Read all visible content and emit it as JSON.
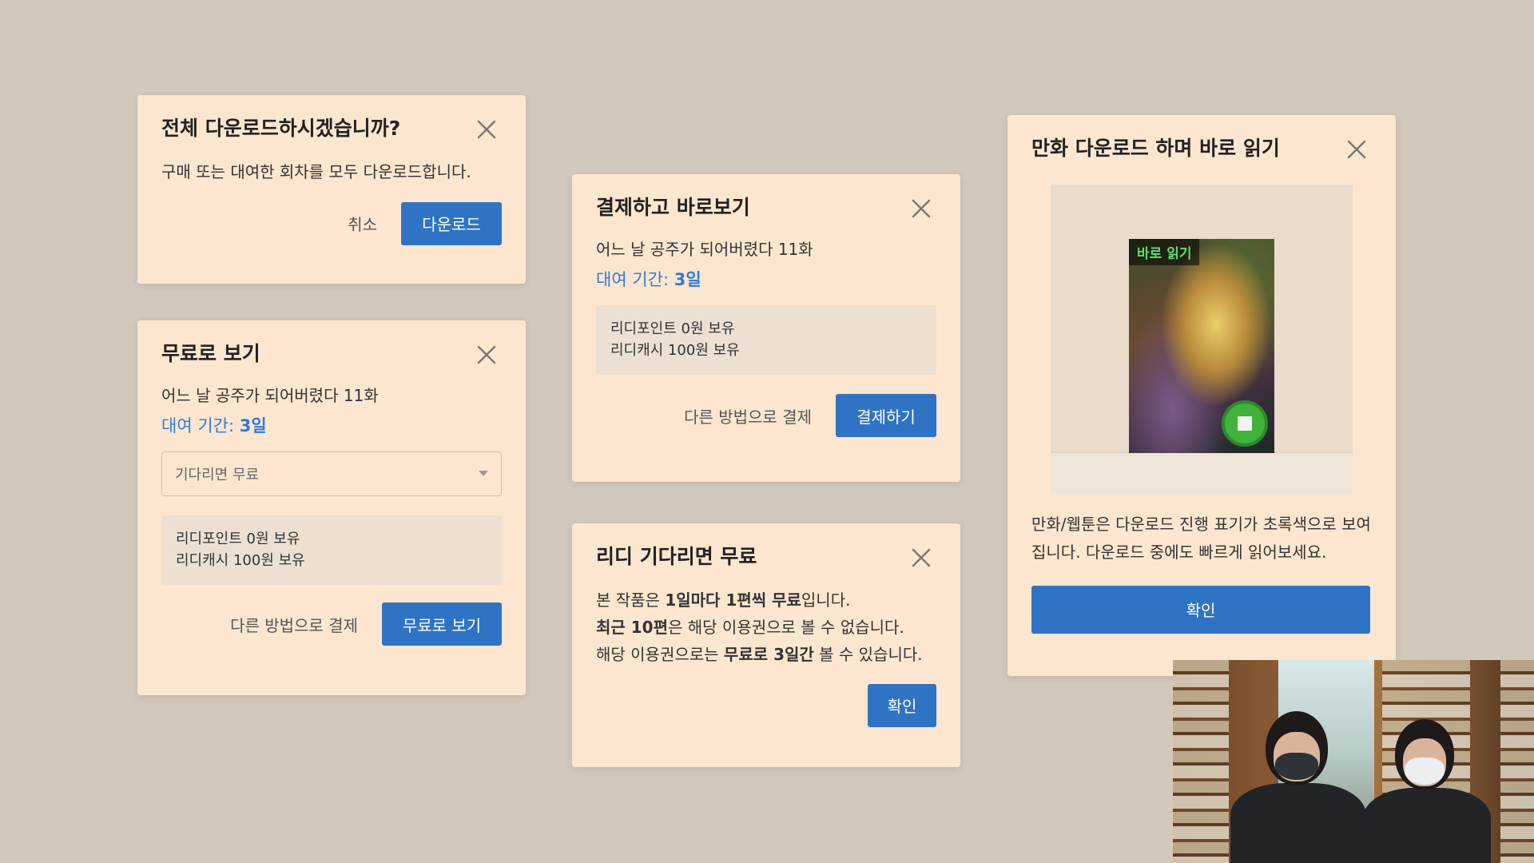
{
  "dialogs": {
    "download_all": {
      "title": "전체 다운로드하시겠습니까?",
      "description": "구매 또는 대여한 회차를 모두 다운로드합니다.",
      "cancel_label": "취소",
      "confirm_label": "다운로드"
    },
    "free_view": {
      "title": "무료로 보기",
      "episode": "어느 날 공주가 되어버렸다 11화",
      "rental_label": "대여 기간: ",
      "rental_value": "3일",
      "select_value": "기다리면 무료",
      "points_line": "리디포인트 0원 보유",
      "cash_line": "리디캐시 100원 보유",
      "alt_pay_label": "다른 방법으로 결제",
      "confirm_label": "무료로 보기"
    },
    "pay_view": {
      "title": "결제하고 바로보기",
      "episode": "어느 날 공주가 되어버렸다 11화",
      "rental_label": "대여 기간: ",
      "rental_value": "3일",
      "points_line": "리디포인트 0원 보유",
      "cash_line": "리디캐시 100원 보유",
      "alt_pay_label": "다른 방법으로 결제",
      "confirm_label": "결제하기"
    },
    "wait_free": {
      "title": "리디 기다리면 무료",
      "line1_a": "본 작품은 ",
      "line1_b": "1일마다 1편씩 무료",
      "line1_c": "입니다.",
      "line2_a": "최근 10편",
      "line2_b": "은 해당 이용권으로 볼 수 없습니다.",
      "line3_a": "해당 이용권으로는 ",
      "line3_b": "무료로 3일간",
      "line3_c": " 볼 수 있습니다.",
      "confirm_label": "확인"
    },
    "comic_download": {
      "title": "만화 다운로드 하며 바로 읽기",
      "cover_badge": "바로 읽기",
      "description": "만화/웹툰은 다운로드 진행 표기가 초록색으로 보여집니다. 다운로드 중에도 빠르게 읽어보세요.",
      "confirm_label": "확인"
    }
  },
  "colors": {
    "background": "#d3c8bc",
    "dialog_bg": "#fde6cf",
    "primary": "#2f73c5",
    "accent_text": "#2f7ad9",
    "download_green": "#3fb33a"
  },
  "icons": {
    "close": "close-icon",
    "dropdown": "chevron-down-icon",
    "stop": "stop-icon"
  }
}
